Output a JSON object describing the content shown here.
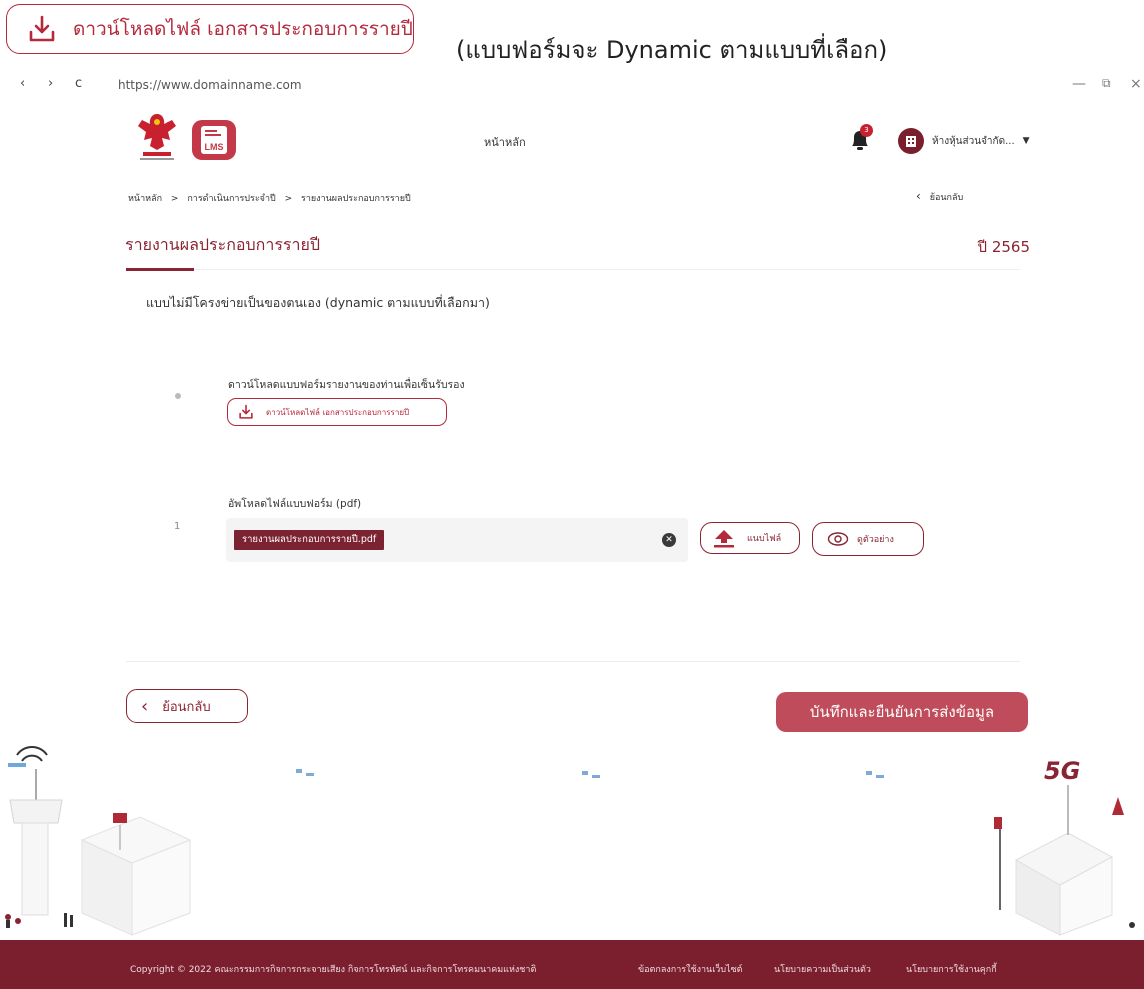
{
  "annotation": {
    "download_label": "ดาวน์โหลดไฟล์ เอกสารประกอบการรายปี",
    "note": "(แบบฟอร์มจะ Dynamic ตามแบบที่เลือก)"
  },
  "browser": {
    "back": "‹",
    "forward": "›",
    "reload": "c",
    "url": "https://www.domainname.com",
    "minimize": "—",
    "restore": "⧉",
    "close": "×"
  },
  "header": {
    "home_link": "หน้าหลัก",
    "notification_count": "3",
    "company_name": "ห้างหุ้นส่วนจำกัด..."
  },
  "breadcrumb": {
    "items": [
      "หน้าหลัก",
      "การดำเนินการประจำปี",
      "รายงานผลประกอบการรายปี"
    ],
    "separator": ">"
  },
  "back_link": "ย้อนกลับ",
  "page": {
    "title": "รายงานผลประกอบการรายปี",
    "year": "ปี 2565",
    "subtitle": "แบบไม่มีโครงข่ายเป็นของตนเอง (dynamic ตามแบบที่เลือกมา)"
  },
  "download_section": {
    "label": "ดาวน์โหลดแบบฟอร์มรายงานของท่านเพื่อเซ็นรับรอง",
    "button": "ดาวน์โหลดไฟล์ เอกสารประกอบการรายปี"
  },
  "upload_section": {
    "label": "อัพโหลดไฟล์แบบฟอร์ม (pdf)",
    "row_number": "1",
    "file_name": "รายงานผลประกอบการรายปี.pdf",
    "attach_button": "แนบไฟล์",
    "preview_button": "ดูตัวอย่าง"
  },
  "actions": {
    "back": "ย้อนกลับ",
    "submit": "บันทึกและยืนยันการส่งข้อมูล"
  },
  "footer": {
    "copyright": "Copyright © 2022 คณะกรรมการกิจการกระจายเสียง กิจการโทรทัศน์ และกิจการโทรคมนาคมแห่งชาติ",
    "links": [
      "ข้อตกลงการใช้งานเว็บไซต์",
      "นโยบายความเป็นส่วนตัว",
      "นโยบายการใช้งานคุกกี้"
    ]
  },
  "illustration": {
    "label": "5G"
  },
  "colors": {
    "primary": "#8a2432",
    "button": "#bf4c5a",
    "footer": "#7b1f2e"
  }
}
